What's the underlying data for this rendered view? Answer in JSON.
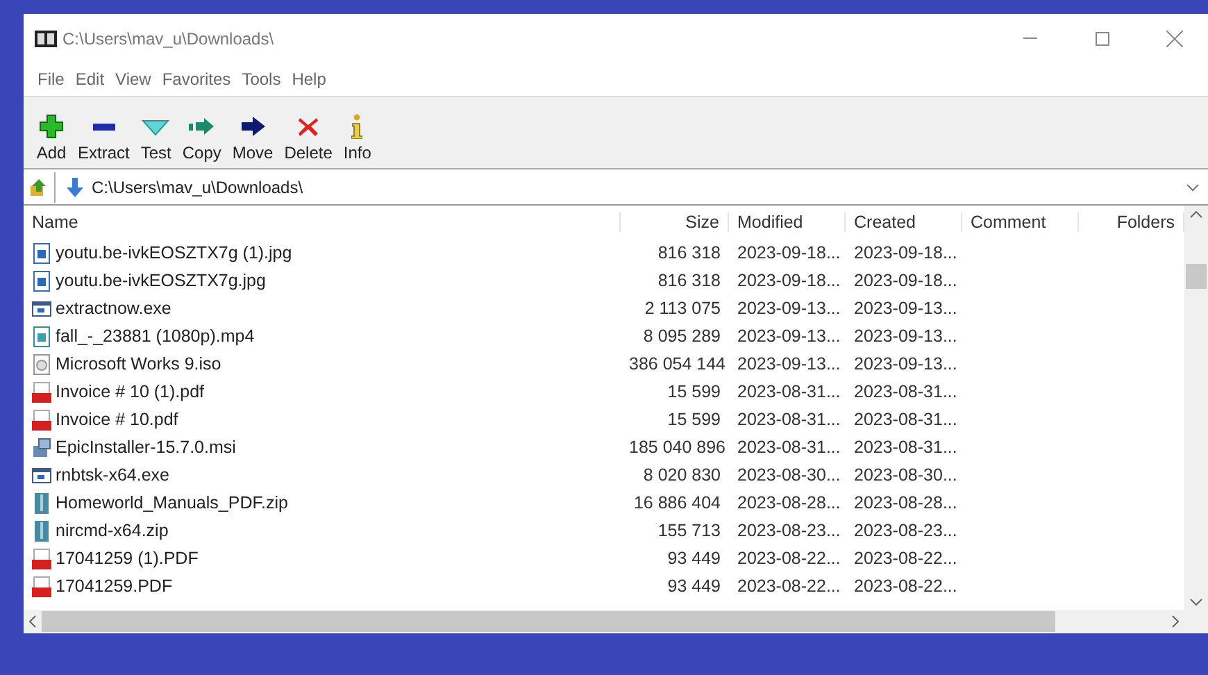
{
  "window": {
    "title": "C:\\Users\\mav_u\\Downloads\\"
  },
  "menu": [
    "File",
    "Edit",
    "View",
    "Favorites",
    "Tools",
    "Help"
  ],
  "toolbar": [
    {
      "kind": "add",
      "label": "Add"
    },
    {
      "kind": "extract",
      "label": "Extract"
    },
    {
      "kind": "test",
      "label": "Test"
    },
    {
      "kind": "copy",
      "label": "Copy"
    },
    {
      "kind": "move",
      "label": "Move"
    },
    {
      "kind": "delete",
      "label": "Delete"
    },
    {
      "kind": "info",
      "label": "Info"
    }
  ],
  "address": {
    "value": "C:\\Users\\mav_u\\Downloads\\"
  },
  "table": {
    "columns": [
      "Name",
      "Size",
      "Modified",
      "Created",
      "Comment",
      "Folders"
    ],
    "rows": [
      {
        "kind": "image",
        "name": "youtu.be-ivkEOSZTX7g (1).jpg",
        "size": "816 318",
        "modified": "2023-09-18...",
        "created": "2023-09-18..."
      },
      {
        "kind": "image",
        "name": "youtu.be-ivkEOSZTX7g.jpg",
        "size": "816 318",
        "modified": "2023-09-18...",
        "created": "2023-09-18..."
      },
      {
        "kind": "exe",
        "name": "extractnow.exe",
        "size": "2 113 075",
        "modified": "2023-09-13...",
        "created": "2023-09-13..."
      },
      {
        "kind": "video",
        "name": "fall_-_23881 (1080p).mp4",
        "size": "8 095 289",
        "modified": "2023-09-13...",
        "created": "2023-09-13..."
      },
      {
        "kind": "disc",
        "name": "Microsoft Works 9.iso",
        "size": "386 054 144",
        "modified": "2023-09-13...",
        "created": "2023-09-13..."
      },
      {
        "kind": "pdf",
        "name": "Invoice # 10 (1).pdf",
        "size": "15 599",
        "modified": "2023-08-31...",
        "created": "2023-08-31..."
      },
      {
        "kind": "pdf",
        "name": "Invoice # 10.pdf",
        "size": "15 599",
        "modified": "2023-08-31...",
        "created": "2023-08-31..."
      },
      {
        "kind": "installer",
        "name": "EpicInstaller-15.7.0.msi",
        "size": "185 040 896",
        "modified": "2023-08-31...",
        "created": "2023-08-31..."
      },
      {
        "kind": "exe",
        "name": "rnbtsk-x64.exe",
        "size": "8 020 830",
        "modified": "2023-08-30...",
        "created": "2023-08-30..."
      },
      {
        "kind": "zip",
        "name": "Homeworld_Manuals_PDF.zip",
        "size": "16 886 404",
        "modified": "2023-08-28...",
        "created": "2023-08-28..."
      },
      {
        "kind": "zip",
        "name": "nircmd-x64.zip",
        "size": "155 713",
        "modified": "2023-08-23...",
        "created": "2023-08-23..."
      },
      {
        "kind": "pdf",
        "name": "17041259 (1).PDF",
        "size": "93 449",
        "modified": "2023-08-22...",
        "created": "2023-08-22..."
      },
      {
        "kind": "pdf",
        "name": "17041259.PDF",
        "size": "93 449",
        "modified": "2023-08-22...",
        "created": "2023-08-22..."
      }
    ]
  }
}
